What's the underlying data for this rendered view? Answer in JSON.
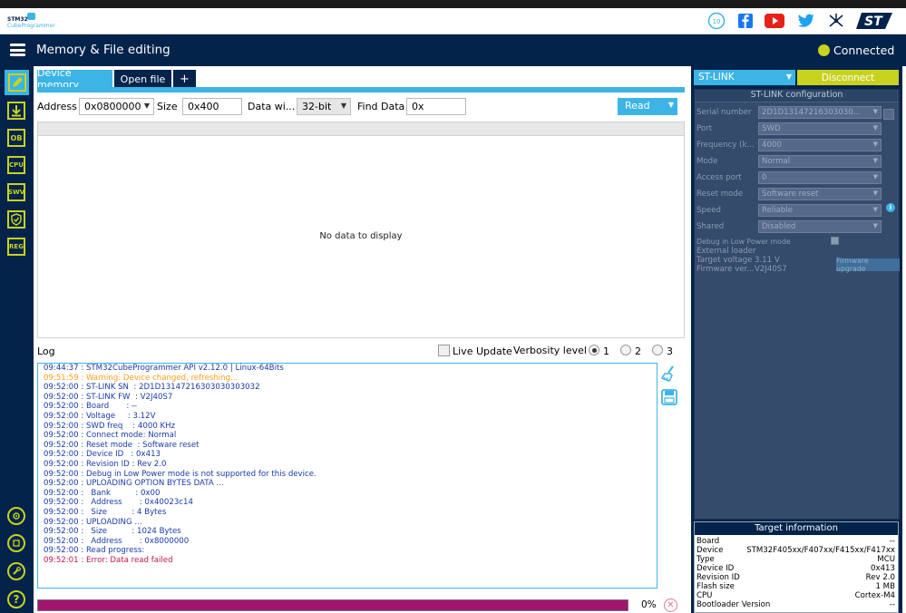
{
  "header": {
    "logo_line1": "STM32",
    "logo_line2": "CubeProgrammer",
    "title": "Memory & File editing",
    "connection_status": "Connected",
    "social_icons": [
      "anniversary-badge-icon",
      "facebook-icon",
      "youtube-icon",
      "twitter-icon",
      "network-icon",
      "st-logo-icon"
    ]
  },
  "nav": {
    "items": [
      {
        "name": "memory-editing",
        "label": ""
      },
      {
        "name": "erase-programming",
        "label": ""
      },
      {
        "name": "option-bytes",
        "label": "OB"
      },
      {
        "name": "mcu-core",
        "label": "CPU"
      },
      {
        "name": "swv",
        "label": "SWV"
      },
      {
        "name": "security",
        "label": ""
      },
      {
        "name": "registers",
        "label": "REG"
      },
      {
        "name": "beta1",
        "label": ""
      },
      {
        "name": "beta2",
        "label": ""
      },
      {
        "name": "tools",
        "label": ""
      },
      {
        "name": "help",
        "label": "?"
      }
    ]
  },
  "tabs": {
    "device_memory": "Device memory",
    "open_file": "Open file",
    "add": "+"
  },
  "toolbar": {
    "address_label": "Address",
    "address_value": "0x0800000",
    "size_label": "Size",
    "size_value": "0x400",
    "data_width_label": "Data wi...",
    "data_width_value": "32-bit",
    "find_label": "Find Data",
    "find_value": "0x",
    "read_label": "Read"
  },
  "data_panel": {
    "empty_text": "No data to display"
  },
  "log": {
    "label": "Log",
    "live_update_label": "Live Update",
    "verbosity_label": "Verbosity level",
    "levels": [
      "1",
      "2",
      "3"
    ],
    "selected_level": "1",
    "lines": [
      {
        "text": "09:44:37 : STM32CubeProgrammer API v2.12.0 | Linux-64Bits",
        "color": "#1a3aa8"
      },
      {
        "text": "09:51:59 : Warning: Device changed, refreshing...",
        "color": "#ff9d1a"
      },
      {
        "text": "09:52:00 : ST-LINK SN  : 2D1D13147216303030303032",
        "color": "#1a3aa8"
      },
      {
        "text": "09:52:00 : ST-LINK FW  : V2J40S7",
        "color": "#1a3aa8"
      },
      {
        "text": "09:52:00 : Board       : --",
        "color": "#1a3aa8"
      },
      {
        "text": "09:52:00 : Voltage     : 3.12V",
        "color": "#1a3aa8"
      },
      {
        "text": "09:52:00 : SWD freq    : 4000 KHz",
        "color": "#1a3aa8"
      },
      {
        "text": "09:52:00 : Connect mode: Normal",
        "color": "#1a3aa8"
      },
      {
        "text": "09:52:00 : Reset mode  : Software reset",
        "color": "#1a3aa8"
      },
      {
        "text": "09:52:00 : Device ID   : 0x413",
        "color": "#1a3aa8"
      },
      {
        "text": "09:52:00 : Revision ID : Rev 2.0",
        "color": "#1a3aa8"
      },
      {
        "text": "09:52:00 : Debug in Low Power mode is not supported for this device.",
        "color": "#1a3aa8"
      },
      {
        "text": "09:52:00 : UPLOADING OPTION BYTES DATA ...",
        "color": "#1a3aa8"
      },
      {
        "text": "09:52:00 :   Bank          : 0x00",
        "color": "#1a3aa8"
      },
      {
        "text": "09:52:00 :   Address       : 0x40023c14",
        "color": "#1a3aa8"
      },
      {
        "text": "09:52:00 :   Size          : 4 Bytes",
        "color": "#1a3aa8"
      },
      {
        "text": "09:52:00 : UPLOADING ...",
        "color": "#1a3aa8"
      },
      {
        "text": "09:52:00 :   Size          : 1024 Bytes",
        "color": "#1a3aa8"
      },
      {
        "text": "09:52:00 :   Address       : 0x8000000",
        "color": "#1a3aa8"
      },
      {
        "text": "09:52:00 : Read progress:",
        "color": "#1a3aa8"
      },
      {
        "text": "09:52:01 : Error: Data read failed",
        "color": "#c0164f"
      }
    ]
  },
  "progress": {
    "percent_text": "0%"
  },
  "right_panel": {
    "probe_select": "ST-LINK",
    "disconnect_label": "Disconnect",
    "config_title": "ST-LINK configuration",
    "fields": [
      {
        "label": "Serial number",
        "value": "2D1D13147216303030..."
      },
      {
        "label": "Port",
        "value": "SWD"
      },
      {
        "label": "Frequency (k...",
        "value": "4000"
      },
      {
        "label": "Mode",
        "value": "Normal"
      },
      {
        "label": "Access port",
        "value": "0"
      },
      {
        "label": "Reset mode",
        "value": "Software reset"
      },
      {
        "label": "Speed",
        "value": "Reliable"
      },
      {
        "label": "Shared",
        "value": "Disabled"
      }
    ],
    "debug_low_power_label": "Debug in Low Power mode",
    "external_loader_label": "External loader",
    "target_voltage_label": "Target voltage",
    "target_voltage_value": "3.11 V",
    "firmware_label": "Firmware ver...",
    "firmware_value": "V2J40S7",
    "firmware_upgrade_label": "Firmware upgrade"
  },
  "target_info": {
    "title": "Target information",
    "rows": [
      {
        "key": "Board",
        "value": "--"
      },
      {
        "key": "Device",
        "value": "STM32F405xx/F407xx/F415xx/F417xx"
      },
      {
        "key": "Type",
        "value": "MCU"
      },
      {
        "key": "Device ID",
        "value": "0x413"
      },
      {
        "key": "Revision ID",
        "value": "Rev 2.0"
      },
      {
        "key": "Flash size",
        "value": "1 MB"
      },
      {
        "key": "CPU",
        "value": "Cortex-M4"
      },
      {
        "key": "Bootloader Version",
        "value": "--"
      }
    ]
  },
  "colors": {
    "navy": "#03234b",
    "accent_blue": "#3cb4e6",
    "accent_lime": "#c8d21e",
    "progress_fill": "#a0146e"
  }
}
